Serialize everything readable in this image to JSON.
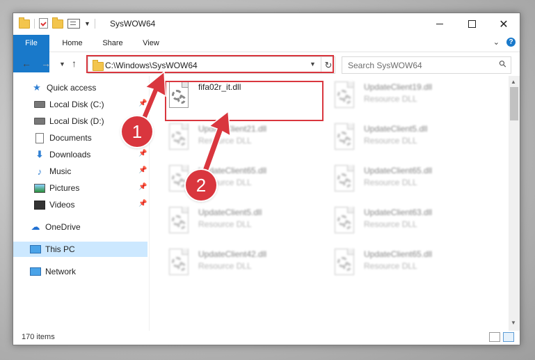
{
  "window": {
    "title": "SysWOW64"
  },
  "ribbon": {
    "tabs": [
      "File",
      "Home",
      "Share",
      "View"
    ]
  },
  "address": {
    "path": "C:\\Windows\\SysWOW64"
  },
  "search": {
    "placeholder": "Search SysWOW64"
  },
  "sidebar": {
    "items": [
      {
        "label": "Quick access",
        "icon": "star-icon"
      },
      {
        "label": "Local Disk (C:)",
        "icon": "drive-icon",
        "pinned": true
      },
      {
        "label": "Local Disk (D:)",
        "icon": "drive-icon",
        "pinned": false
      },
      {
        "label": "Documents",
        "icon": "documents-icon",
        "pinned": true
      },
      {
        "label": "Downloads",
        "icon": "download-icon",
        "pinned": true
      },
      {
        "label": "Music",
        "icon": "music-icon",
        "pinned": true
      },
      {
        "label": "Pictures",
        "icon": "pictures-icon",
        "pinned": true
      },
      {
        "label": "Videos",
        "icon": "videos-icon",
        "pinned": true
      },
      {
        "label": "OneDrive",
        "icon": "onedrive-icon"
      },
      {
        "label": "This PC",
        "icon": "pc-icon",
        "selected": true
      },
      {
        "label": "Network",
        "icon": "network-icon"
      }
    ]
  },
  "files": [
    {
      "name": "fifa02r_it.dll",
      "type": "",
      "blurred": false
    },
    {
      "name": "UpdateClient19.dll",
      "type": "Resource DLL",
      "blurred": true
    },
    {
      "name": "UpdateClient21.dll",
      "type": "Resource DLL",
      "blurred": true
    },
    {
      "name": "UpdateClient5.dll",
      "type": "Resource DLL",
      "blurred": true
    },
    {
      "name": "UpdateClient65.dll",
      "type": "Resource DLL",
      "blurred": true
    },
    {
      "name": "UpdateClient65.dll",
      "type": "Resource DLL",
      "blurred": true
    },
    {
      "name": "UpdateClient5.dll",
      "type": "Resource DLL",
      "blurred": true
    },
    {
      "name": "UpdateClient63.dll",
      "type": "Resource DLL",
      "blurred": true
    },
    {
      "name": "UpdateClient42.dll",
      "type": "Resource DLL",
      "blurred": true
    },
    {
      "name": "UpdateClient65.dll",
      "type": "Resource DLL",
      "blurred": true
    }
  ],
  "status": {
    "item_count": "170 items"
  },
  "annotations": {
    "step1": "1",
    "step2": "2",
    "color": "#d9363e"
  },
  "colors": {
    "accent": "#1979ca",
    "selection": "#cce8ff"
  }
}
